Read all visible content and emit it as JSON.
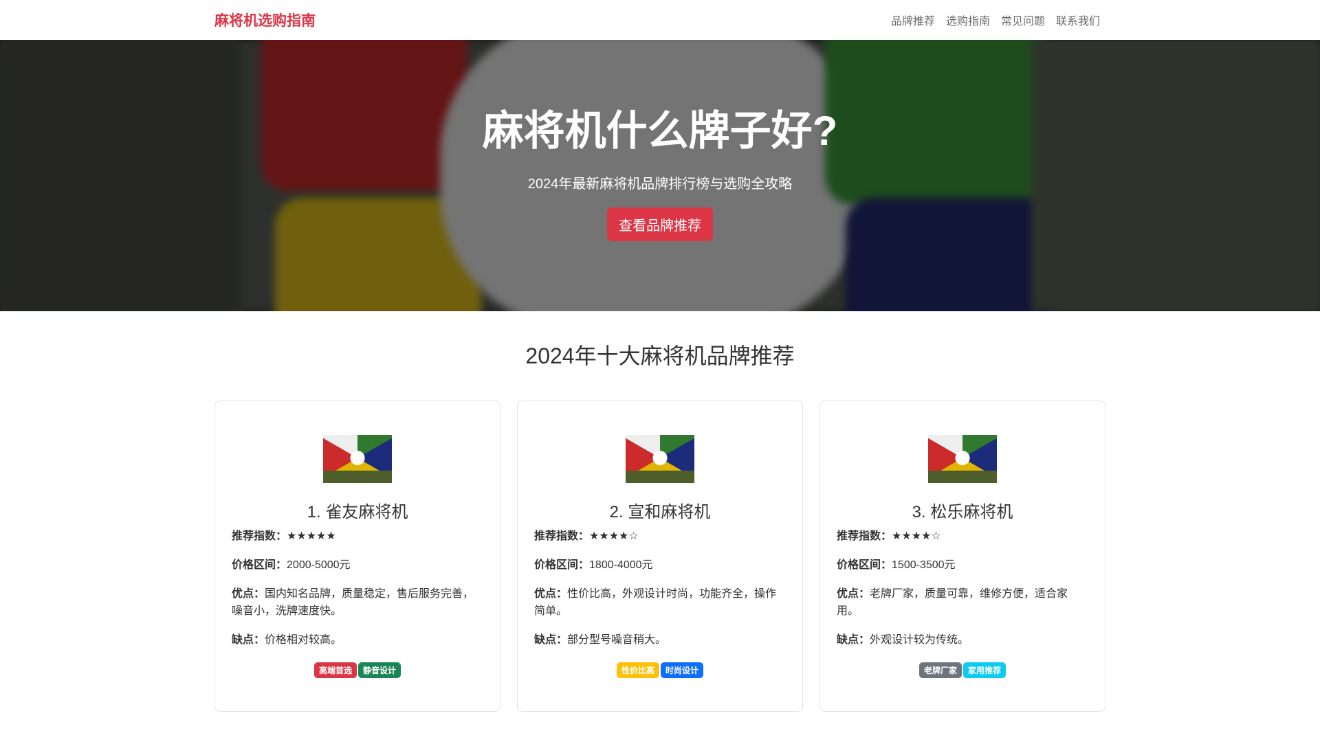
{
  "nav": {
    "brand": "麻将机选购指南",
    "links": [
      "品牌推荐",
      "选购指南",
      "常见问题",
      "联系我们"
    ]
  },
  "hero": {
    "title": "麻将机什么牌子好?",
    "subtitle": "2024年最新麻将机品牌排行榜与选购全攻略",
    "button": "查看品牌推荐"
  },
  "section": {
    "title": "2024年十大麻将机品牌推荐"
  },
  "labels": {
    "rating": "推荐指数：",
    "price": "价格区间：",
    "pros": "优点：",
    "cons": "缺点："
  },
  "cards": [
    {
      "title": "1. 雀友麻将机",
      "rating": "★★★★★",
      "price": "2000-5000元",
      "pros": "国内知名品牌，质量稳定，售后服务完善，噪音小，洗牌速度快。",
      "cons": "价格相对较高。",
      "badges": [
        {
          "text": "高端首选",
          "color": "#dc3545"
        },
        {
          "text": "静音设计",
          "color": "#198754"
        }
      ]
    },
    {
      "title": "2. 宣和麻将机",
      "rating": "★★★★☆",
      "price": "1800-4000元",
      "pros": "性价比高，外观设计时尚，功能齐全，操作简单。",
      "cons": "部分型号噪音稍大。",
      "badges": [
        {
          "text": "性价比高",
          "color": "#ffc107"
        },
        {
          "text": "时尚设计",
          "color": "#0d6efd"
        }
      ]
    },
    {
      "title": "3. 松乐麻将机",
      "rating": "★★★★☆",
      "price": "1500-3500元",
      "pros": "老牌厂家，质量可靠，维修方便，适合家用。",
      "cons": "外观设计较为传统。",
      "badges": [
        {
          "text": "老牌厂家",
          "color": "#6c757d"
        },
        {
          "text": "家用推荐",
          "color": "#0dcaf0"
        }
      ]
    }
  ]
}
